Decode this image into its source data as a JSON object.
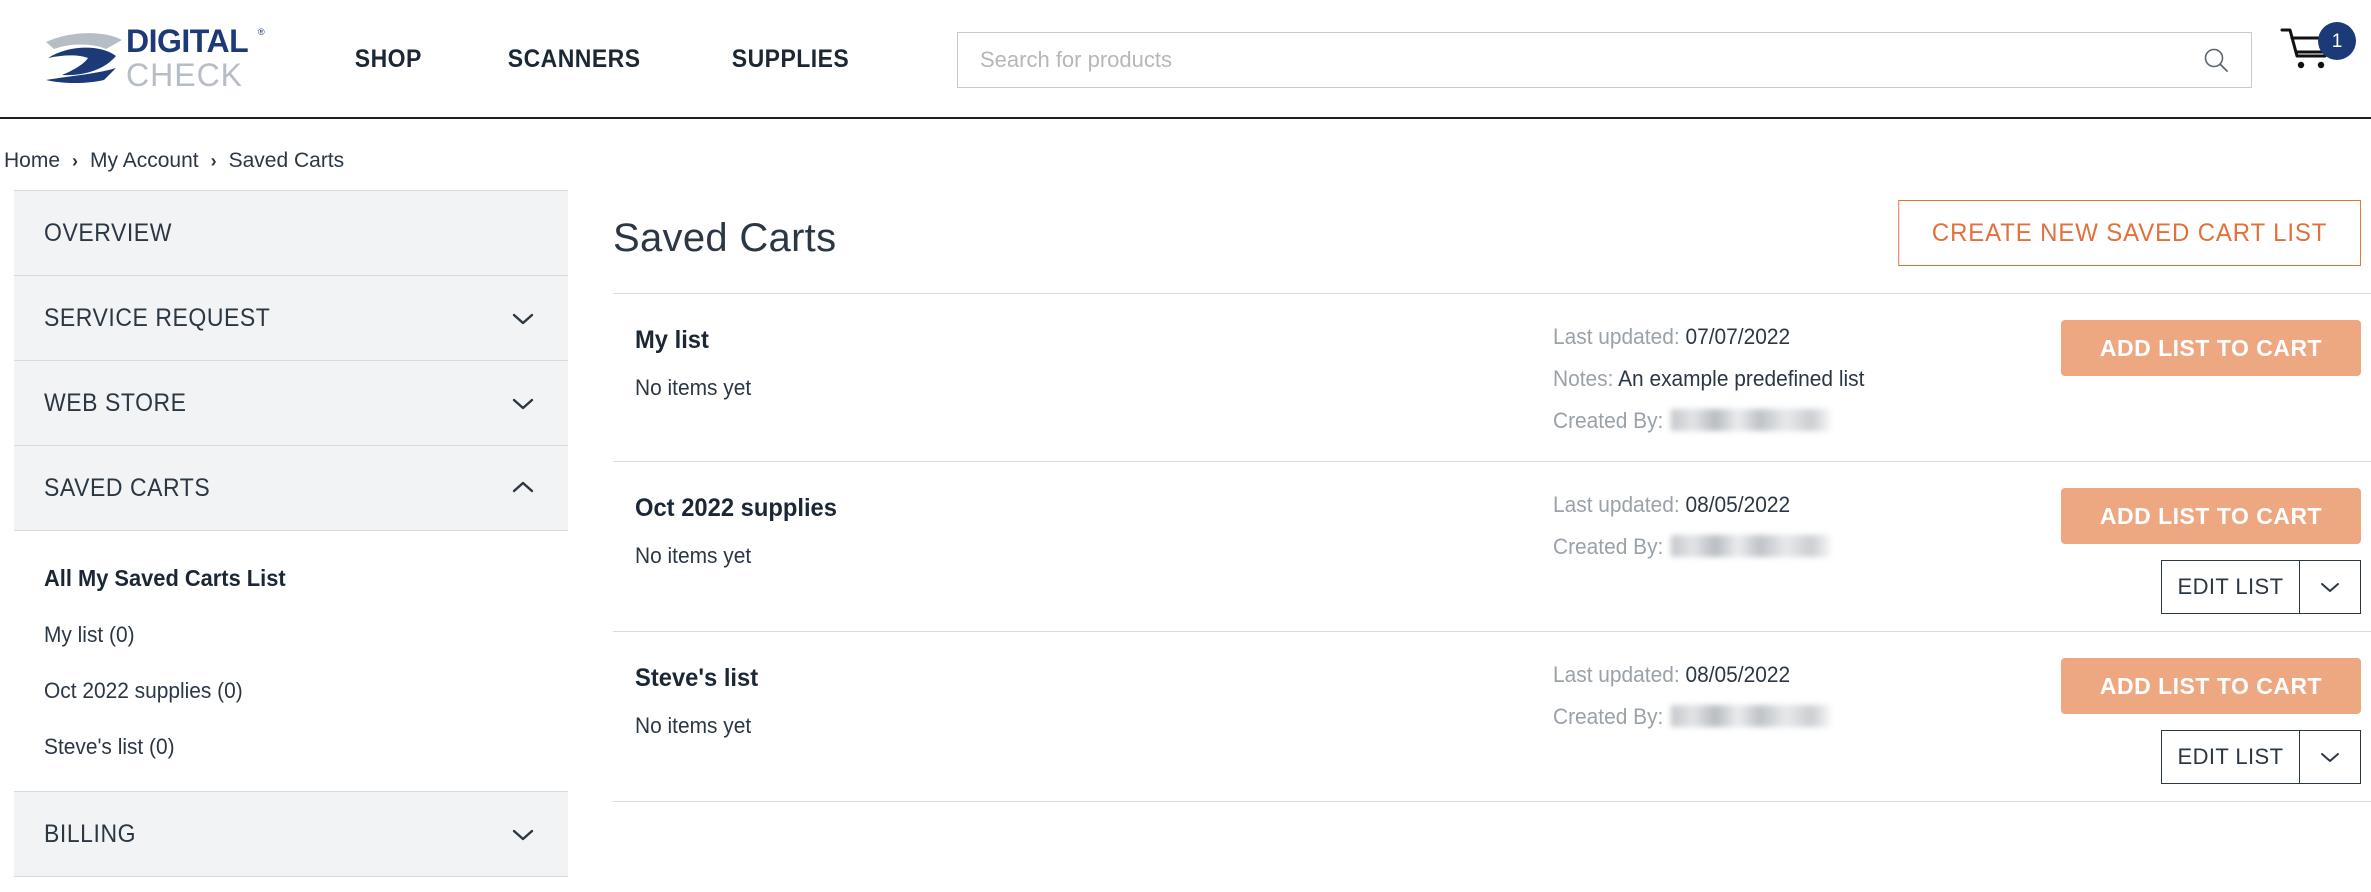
{
  "header": {
    "logo": {
      "icon": "digital-check-logo",
      "line1": "DIGITAL",
      "line2": "CHECK",
      "registered": "®"
    },
    "nav": [
      {
        "label": "SHOP"
      },
      {
        "label": "SCANNERS"
      },
      {
        "label": "SUPPLIES"
      }
    ],
    "search": {
      "placeholder": "Search for products",
      "value": "",
      "icon": "search-icon"
    },
    "cart": {
      "icon": "shopping-cart-icon",
      "count": "1",
      "badge_color": "#1b3a77"
    }
  },
  "breadcrumb": {
    "items": [
      {
        "label": "Home"
      },
      {
        "label": "My Account"
      },
      {
        "label": "Saved Carts"
      }
    ],
    "separator": "›"
  },
  "sidebar": {
    "sections": [
      {
        "label": "OVERVIEW",
        "chevron": "none",
        "expanded": false
      },
      {
        "label": "SERVICE REQUEST",
        "chevron": "chevron-down-icon",
        "expanded": false
      },
      {
        "label": "WEB STORE",
        "chevron": "chevron-down-icon",
        "expanded": false
      },
      {
        "label": "SAVED CARTS",
        "chevron": "chevron-up-icon",
        "expanded": true
      }
    ],
    "saved_carts_sub": {
      "title": "All My Saved Carts List",
      "items": [
        {
          "label": "My list (0)"
        },
        {
          "label": "Oct 2022 supplies (0)"
        },
        {
          "label": "Steve's list (0)"
        }
      ]
    },
    "billing": {
      "label": "BILLING",
      "chevron": "chevron-down-icon"
    }
  },
  "main": {
    "title": "Saved Carts",
    "create_button": "CREATE NEW SAVED CART LIST",
    "labels": {
      "last_updated": "Last updated:",
      "notes": "Notes:",
      "created_by": "Created By:",
      "add_to_cart": "ADD LIST TO CART",
      "edit_list": "EDIT LIST"
    },
    "rows": [
      {
        "name": "My list",
        "items_text": "No items yet",
        "last_updated": "07/07/2022",
        "notes": "An example predefined list",
        "created_by": "",
        "has_edit": false
      },
      {
        "name": "Oct 2022 supplies",
        "items_text": "No items yet",
        "last_updated": "08/05/2022",
        "notes": null,
        "created_by": "",
        "has_edit": true
      },
      {
        "name": "Steve's list",
        "items_text": "No items yet",
        "last_updated": "08/05/2022",
        "notes": null,
        "created_by": "",
        "has_edit": true
      }
    ]
  },
  "colors": {
    "brand_blue": "#1b3a77",
    "accent_orange": "#e2703a",
    "add_button": "#eda882",
    "sidebar_bg": "#f1f3f4",
    "text": "#2c3744",
    "muted": "#9aa2a9"
  }
}
